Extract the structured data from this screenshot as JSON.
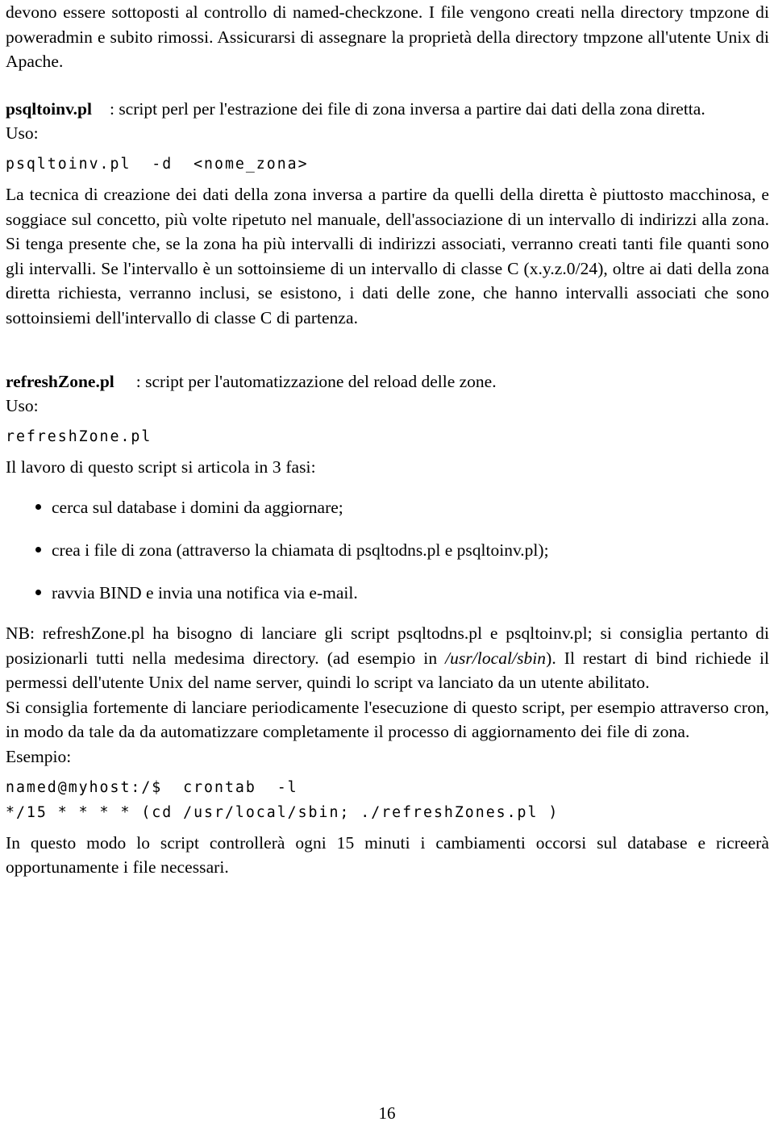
{
  "document": {
    "page_number": "16",
    "language": "it"
  },
  "blocks": {
    "intro_paragraph": "devono essere sottoposti al controllo di named-checkzone. I file vengono creati nella directory tmpzone di poweradmin e subito rimossi. Assicurarsi di assegnare la proprietà della directory tmpzone all'utente Unix di Apache.",
    "psqltoinv": {
      "name": "psqltoinv.pl",
      "description": ": script perl per l'estrazione dei file di zona inversa a partire dai dati della zona diretta.",
      "uso_label": "Uso:",
      "usage_code": "psqltoinv.pl  -d  <nome_zona>",
      "body_paragraph": "La tecnica di creazione dei dati della zona inversa a partire da quelli della diretta è piuttosto macchinosa, e soggiace sul concetto, più volte ripetuto nel manuale, dell'associazione di un intervallo di indirizzi alla zona. Si tenga presente che, se la zona ha più intervalli di indirizzi associati, verranno creati tanti file quanti sono gli intervalli. Se l'intervallo è un sottoinsieme di un intervallo di classe C (x.y.z.0/24), oltre ai dati della zona diretta richiesta, verranno inclusi, se esistono, i dati delle zone, che hanno intervalli associati che sono sottoinsiemi dell'intervallo di classe C di partenza."
    },
    "refreshzone": {
      "name": "refreshZone.pl",
      "description": ": script per l'automatizzazione del reload delle zone.",
      "uso_label": "Uso:",
      "usage_code": "refreshZone.pl",
      "phases_intro": "Il lavoro di questo script si articola in 3 fasi:",
      "phases": [
        "cerca sul database i domini da aggiornare;",
        "crea i file di zona (attraverso la chiamata di psqltodns.pl e psqltoinv.pl);",
        "ravvia BIND e invia una notifica via e-mail."
      ],
      "note_part1": "NB: refreshZone.pl ha bisogno di lanciare gli script psqltodns.pl e psqltoinv.pl; si consiglia pertanto di posizionarli tutti nella medesima directory. (ad esempio in ",
      "note_path_italic": "/usr/local/sbin",
      "note_part2": "). Il restart di bind richiede il permessi dell'utente Unix del name server, quindi lo script va lanciato da un utente abilitato.",
      "cron_advice": "Si consiglia fortemente di lanciare periodicamente l'esecuzione di questo script, per esempio attraverso cron, in modo da tale da da automatizzare completamente il processo di aggiornamento dei file di zona.",
      "esempio_label": "Esempio:",
      "cron_code_line1": "named@myhost:/$  crontab  -l",
      "cron_code_line2": "*/15 * * * * (cd /usr/local/sbin; ./refreshZones.pl )",
      "closing_paragraph": "In questo modo lo script controllerà ogni 15 minuti i cambiamenti occorsi sul database e ricreerà opportunamente i file necessari."
    }
  }
}
